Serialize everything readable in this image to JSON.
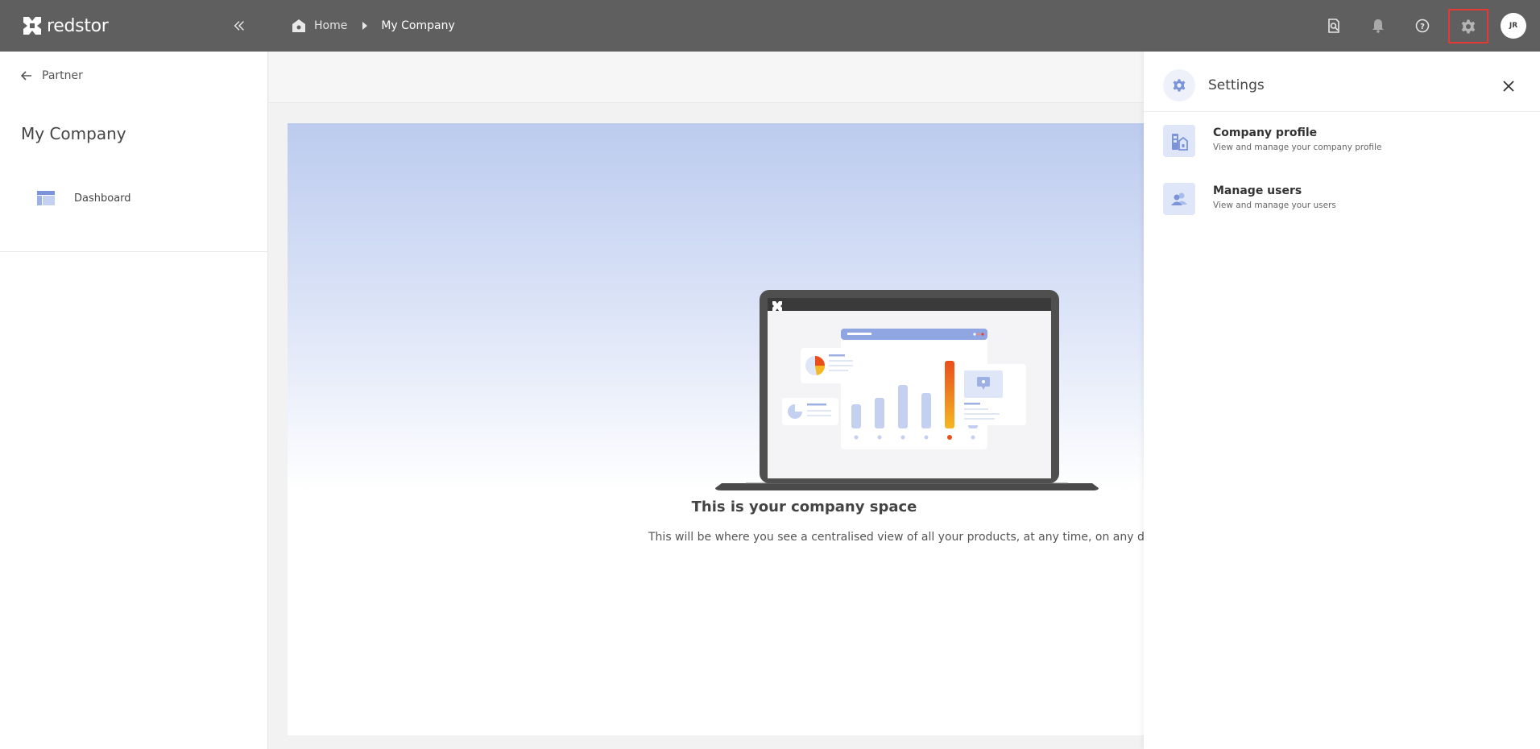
{
  "app": {
    "brand": "redstor"
  },
  "breadcrumb": {
    "home": "Home",
    "current": "My Company"
  },
  "user": {
    "initials": "JR"
  },
  "sidebar": {
    "back_label": "Partner",
    "title": "My Company",
    "items": [
      {
        "label": "Dashboard",
        "icon": "dashboard-icon"
      }
    ]
  },
  "main": {
    "title": "This is your company space",
    "subtitle": "This will be where you see a centralised view of all your products, at any time, on any dev"
  },
  "settings": {
    "title": "Settings",
    "options": [
      {
        "title": "Company profile",
        "desc": "View and manage your company profile",
        "icon": "company-building-icon"
      },
      {
        "title": "Manage users",
        "desc": "View and manage your users",
        "icon": "users-icon"
      }
    ]
  },
  "colors": {
    "topbar": "#5f5f5f",
    "accent": "#7b94d9",
    "highlight_border": "#e53935",
    "hero_gradient_top": "#bccbee"
  }
}
